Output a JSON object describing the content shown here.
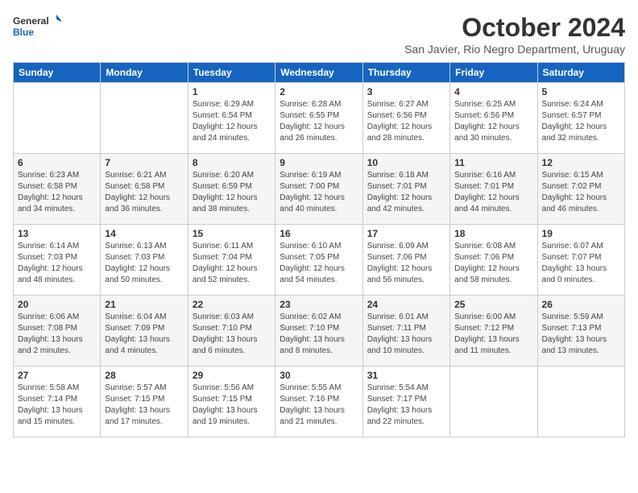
{
  "logo": {
    "text_general": "General",
    "text_blue": "Blue"
  },
  "header": {
    "month": "October 2024",
    "location": "San Javier, Rio Negro Department, Uruguay"
  },
  "weekdays": [
    "Sunday",
    "Monday",
    "Tuesday",
    "Wednesday",
    "Thursday",
    "Friday",
    "Saturday"
  ],
  "weeks": [
    [
      {
        "day": "",
        "info": ""
      },
      {
        "day": "",
        "info": ""
      },
      {
        "day": "1",
        "info": "Sunrise: 6:29 AM\nSunset: 6:54 PM\nDaylight: 12 hours\nand 24 minutes."
      },
      {
        "day": "2",
        "info": "Sunrise: 6:28 AM\nSunset: 6:55 PM\nDaylight: 12 hours\nand 26 minutes."
      },
      {
        "day": "3",
        "info": "Sunrise: 6:27 AM\nSunset: 6:56 PM\nDaylight: 12 hours\nand 28 minutes."
      },
      {
        "day": "4",
        "info": "Sunrise: 6:25 AM\nSunset: 6:56 PM\nDaylight: 12 hours\nand 30 minutes."
      },
      {
        "day": "5",
        "info": "Sunrise: 6:24 AM\nSunset: 6:57 PM\nDaylight: 12 hours\nand 32 minutes."
      }
    ],
    [
      {
        "day": "6",
        "info": "Sunrise: 6:23 AM\nSunset: 6:58 PM\nDaylight: 12 hours\nand 34 minutes."
      },
      {
        "day": "7",
        "info": "Sunrise: 6:21 AM\nSunset: 6:58 PM\nDaylight: 12 hours\nand 36 minutes."
      },
      {
        "day": "8",
        "info": "Sunrise: 6:20 AM\nSunset: 6:59 PM\nDaylight: 12 hours\nand 38 minutes."
      },
      {
        "day": "9",
        "info": "Sunrise: 6:19 AM\nSunset: 7:00 PM\nDaylight: 12 hours\nand 40 minutes."
      },
      {
        "day": "10",
        "info": "Sunrise: 6:18 AM\nSunset: 7:01 PM\nDaylight: 12 hours\nand 42 minutes."
      },
      {
        "day": "11",
        "info": "Sunrise: 6:16 AM\nSunset: 7:01 PM\nDaylight: 12 hours\nand 44 minutes."
      },
      {
        "day": "12",
        "info": "Sunrise: 6:15 AM\nSunset: 7:02 PM\nDaylight: 12 hours\nand 46 minutes."
      }
    ],
    [
      {
        "day": "13",
        "info": "Sunrise: 6:14 AM\nSunset: 7:03 PM\nDaylight: 12 hours\nand 48 minutes."
      },
      {
        "day": "14",
        "info": "Sunrise: 6:13 AM\nSunset: 7:03 PM\nDaylight: 12 hours\nand 50 minutes."
      },
      {
        "day": "15",
        "info": "Sunrise: 6:11 AM\nSunset: 7:04 PM\nDaylight: 12 hours\nand 52 minutes."
      },
      {
        "day": "16",
        "info": "Sunrise: 6:10 AM\nSunset: 7:05 PM\nDaylight: 12 hours\nand 54 minutes."
      },
      {
        "day": "17",
        "info": "Sunrise: 6:09 AM\nSunset: 7:06 PM\nDaylight: 12 hours\nand 56 minutes."
      },
      {
        "day": "18",
        "info": "Sunrise: 6:08 AM\nSunset: 7:06 PM\nDaylight: 12 hours\nand 58 minutes."
      },
      {
        "day": "19",
        "info": "Sunrise: 6:07 AM\nSunset: 7:07 PM\nDaylight: 13 hours\nand 0 minutes."
      }
    ],
    [
      {
        "day": "20",
        "info": "Sunrise: 6:06 AM\nSunset: 7:08 PM\nDaylight: 13 hours\nand 2 minutes."
      },
      {
        "day": "21",
        "info": "Sunrise: 6:04 AM\nSunset: 7:09 PM\nDaylight: 13 hours\nand 4 minutes."
      },
      {
        "day": "22",
        "info": "Sunrise: 6:03 AM\nSunset: 7:10 PM\nDaylight: 13 hours\nand 6 minutes."
      },
      {
        "day": "23",
        "info": "Sunrise: 6:02 AM\nSunset: 7:10 PM\nDaylight: 13 hours\nand 8 minutes."
      },
      {
        "day": "24",
        "info": "Sunrise: 6:01 AM\nSunset: 7:11 PM\nDaylight: 13 hours\nand 10 minutes."
      },
      {
        "day": "25",
        "info": "Sunrise: 6:00 AM\nSunset: 7:12 PM\nDaylight: 13 hours\nand 11 minutes."
      },
      {
        "day": "26",
        "info": "Sunrise: 5:59 AM\nSunset: 7:13 PM\nDaylight: 13 hours\nand 13 minutes."
      }
    ],
    [
      {
        "day": "27",
        "info": "Sunrise: 5:58 AM\nSunset: 7:14 PM\nDaylight: 13 hours\nand 15 minutes."
      },
      {
        "day": "28",
        "info": "Sunrise: 5:57 AM\nSunset: 7:15 PM\nDaylight: 13 hours\nand 17 minutes."
      },
      {
        "day": "29",
        "info": "Sunrise: 5:56 AM\nSunset: 7:15 PM\nDaylight: 13 hours\nand 19 minutes."
      },
      {
        "day": "30",
        "info": "Sunrise: 5:55 AM\nSunset: 7:16 PM\nDaylight: 13 hours\nand 21 minutes."
      },
      {
        "day": "31",
        "info": "Sunrise: 5:54 AM\nSunset: 7:17 PM\nDaylight: 13 hours\nand 22 minutes."
      },
      {
        "day": "",
        "info": ""
      },
      {
        "day": "",
        "info": ""
      }
    ]
  ]
}
